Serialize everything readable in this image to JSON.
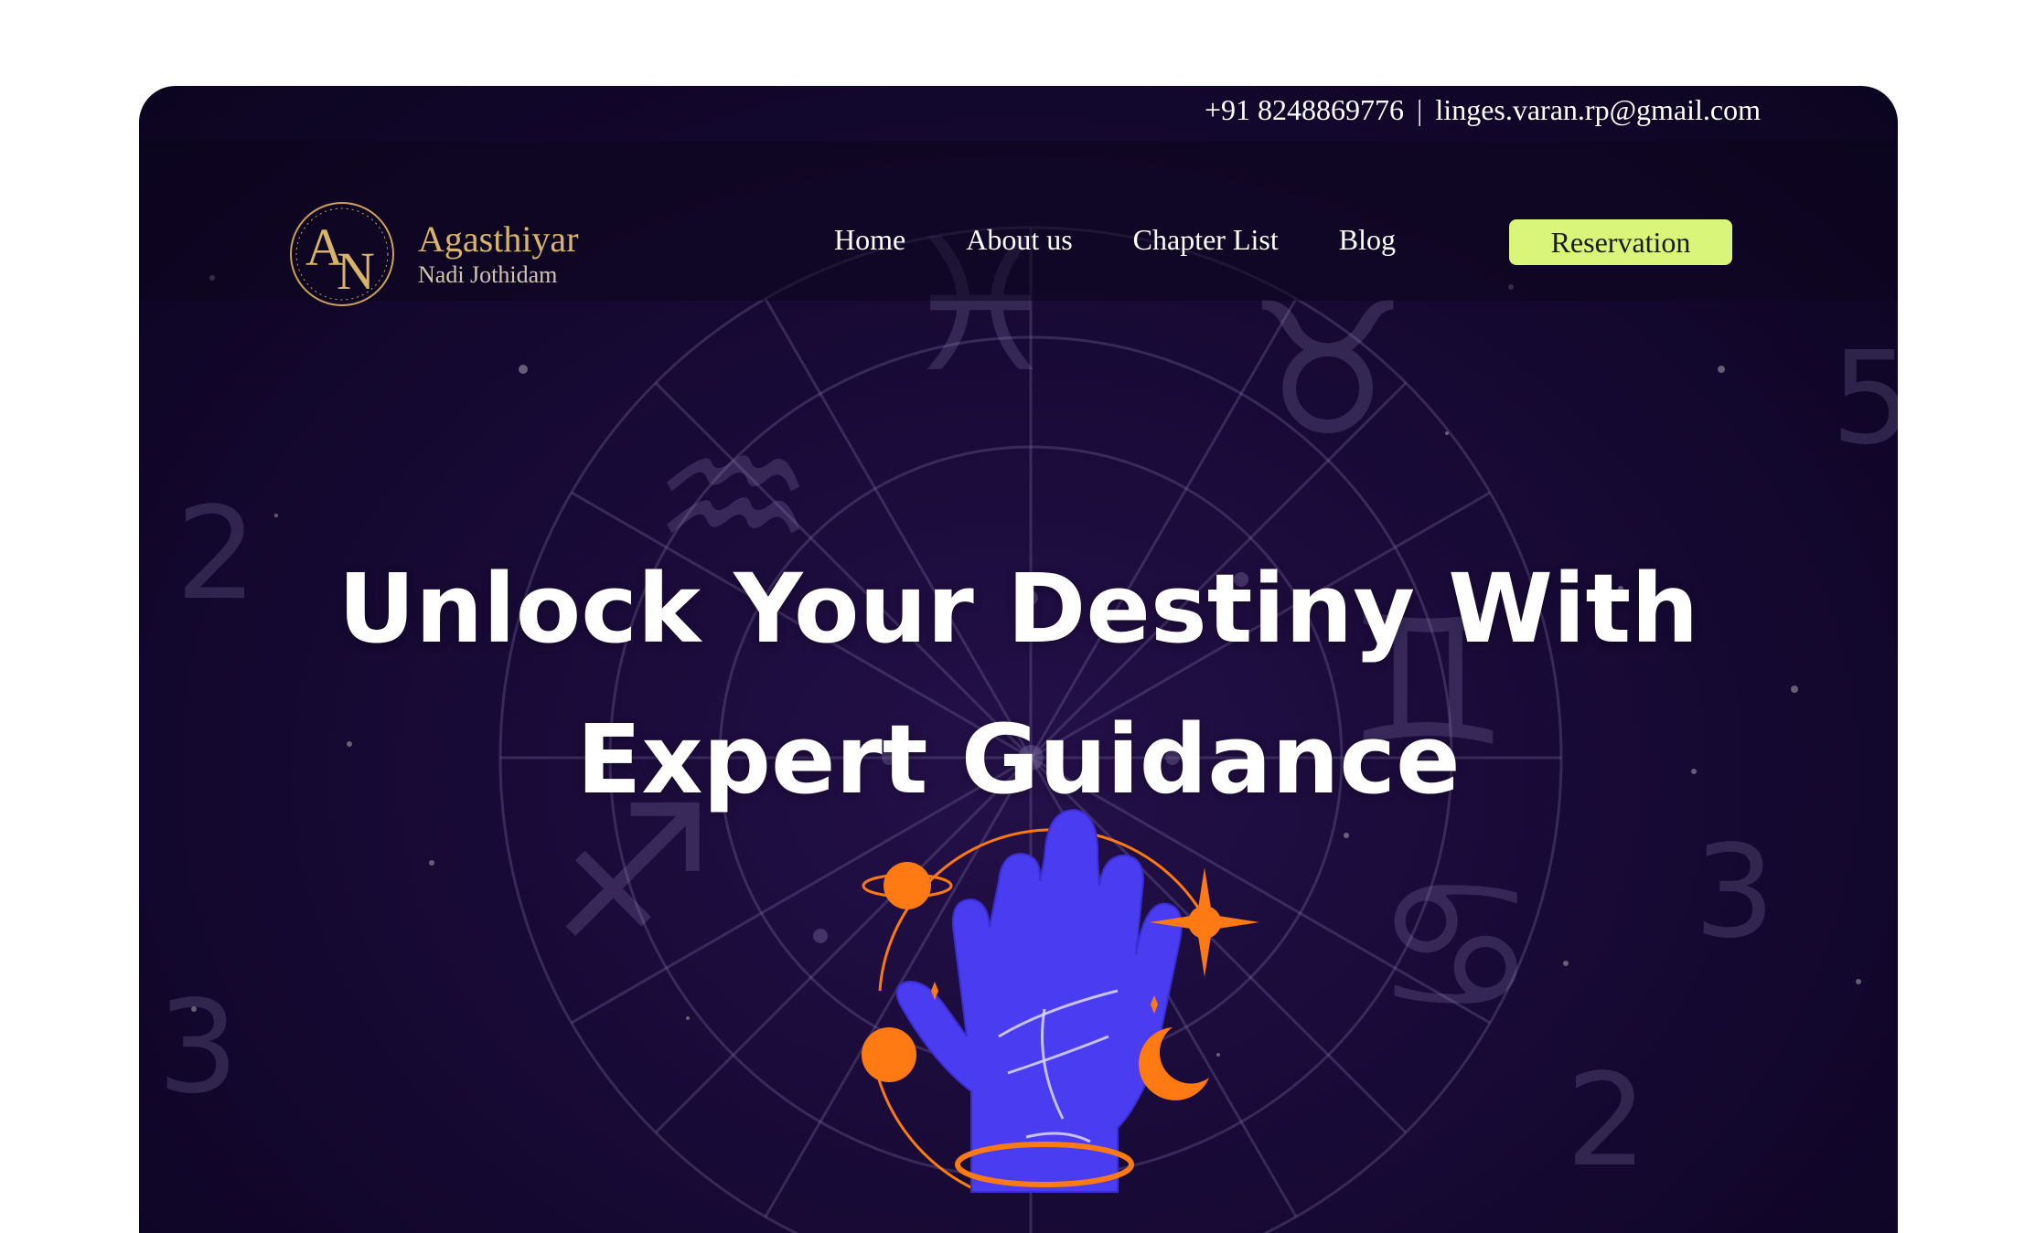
{
  "contact": {
    "phone": "+91 8248869776",
    "separator": "|",
    "email": "linges.varan.rp@gmail.com"
  },
  "brand": {
    "name": "Agasthiyar",
    "subtitle": "Nadi Jothidam",
    "logo_icon": "an-monogram-logo"
  },
  "nav": {
    "items": [
      {
        "label": "Home"
      },
      {
        "label": "About us"
      },
      {
        "label": "Chapter List"
      },
      {
        "label": "Blog"
      }
    ],
    "cta_label": "Reservation"
  },
  "hero": {
    "line1": "Unlock Your Destiny With",
    "line2": "Expert Guidance",
    "illustration_icon": "palmistry-hand-icon"
  },
  "colors": {
    "background": "#12072c",
    "accent_cta": "#d9f57a",
    "brand_gold": "#d7b46a",
    "hand_blue": "#4a3cf0",
    "planet_orange": "#ff7a12"
  }
}
